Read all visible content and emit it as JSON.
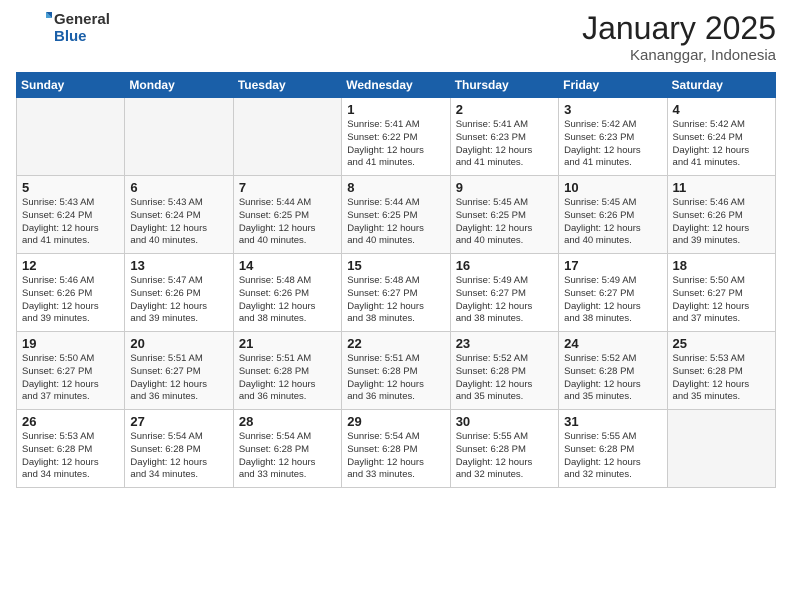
{
  "logo": {
    "general": "General",
    "blue": "Blue"
  },
  "title": {
    "month": "January 2025",
    "location": "Kananggar, Indonesia"
  },
  "weekdays": [
    "Sunday",
    "Monday",
    "Tuesday",
    "Wednesday",
    "Thursday",
    "Friday",
    "Saturday"
  ],
  "weeks": [
    [
      {
        "day": "",
        "info": ""
      },
      {
        "day": "",
        "info": ""
      },
      {
        "day": "",
        "info": ""
      },
      {
        "day": "1",
        "info": "Sunrise: 5:41 AM\nSunset: 6:22 PM\nDaylight: 12 hours\nand 41 minutes."
      },
      {
        "day": "2",
        "info": "Sunrise: 5:41 AM\nSunset: 6:23 PM\nDaylight: 12 hours\nand 41 minutes."
      },
      {
        "day": "3",
        "info": "Sunrise: 5:42 AM\nSunset: 6:23 PM\nDaylight: 12 hours\nand 41 minutes."
      },
      {
        "day": "4",
        "info": "Sunrise: 5:42 AM\nSunset: 6:24 PM\nDaylight: 12 hours\nand 41 minutes."
      }
    ],
    [
      {
        "day": "5",
        "info": "Sunrise: 5:43 AM\nSunset: 6:24 PM\nDaylight: 12 hours\nand 41 minutes."
      },
      {
        "day": "6",
        "info": "Sunrise: 5:43 AM\nSunset: 6:24 PM\nDaylight: 12 hours\nand 40 minutes."
      },
      {
        "day": "7",
        "info": "Sunrise: 5:44 AM\nSunset: 6:25 PM\nDaylight: 12 hours\nand 40 minutes."
      },
      {
        "day": "8",
        "info": "Sunrise: 5:44 AM\nSunset: 6:25 PM\nDaylight: 12 hours\nand 40 minutes."
      },
      {
        "day": "9",
        "info": "Sunrise: 5:45 AM\nSunset: 6:25 PM\nDaylight: 12 hours\nand 40 minutes."
      },
      {
        "day": "10",
        "info": "Sunrise: 5:45 AM\nSunset: 6:26 PM\nDaylight: 12 hours\nand 40 minutes."
      },
      {
        "day": "11",
        "info": "Sunrise: 5:46 AM\nSunset: 6:26 PM\nDaylight: 12 hours\nand 39 minutes."
      }
    ],
    [
      {
        "day": "12",
        "info": "Sunrise: 5:46 AM\nSunset: 6:26 PM\nDaylight: 12 hours\nand 39 minutes."
      },
      {
        "day": "13",
        "info": "Sunrise: 5:47 AM\nSunset: 6:26 PM\nDaylight: 12 hours\nand 39 minutes."
      },
      {
        "day": "14",
        "info": "Sunrise: 5:48 AM\nSunset: 6:26 PM\nDaylight: 12 hours\nand 38 minutes."
      },
      {
        "day": "15",
        "info": "Sunrise: 5:48 AM\nSunset: 6:27 PM\nDaylight: 12 hours\nand 38 minutes."
      },
      {
        "day": "16",
        "info": "Sunrise: 5:49 AM\nSunset: 6:27 PM\nDaylight: 12 hours\nand 38 minutes."
      },
      {
        "day": "17",
        "info": "Sunrise: 5:49 AM\nSunset: 6:27 PM\nDaylight: 12 hours\nand 38 minutes."
      },
      {
        "day": "18",
        "info": "Sunrise: 5:50 AM\nSunset: 6:27 PM\nDaylight: 12 hours\nand 37 minutes."
      }
    ],
    [
      {
        "day": "19",
        "info": "Sunrise: 5:50 AM\nSunset: 6:27 PM\nDaylight: 12 hours\nand 37 minutes."
      },
      {
        "day": "20",
        "info": "Sunrise: 5:51 AM\nSunset: 6:27 PM\nDaylight: 12 hours\nand 36 minutes."
      },
      {
        "day": "21",
        "info": "Sunrise: 5:51 AM\nSunset: 6:28 PM\nDaylight: 12 hours\nand 36 minutes."
      },
      {
        "day": "22",
        "info": "Sunrise: 5:51 AM\nSunset: 6:28 PM\nDaylight: 12 hours\nand 36 minutes."
      },
      {
        "day": "23",
        "info": "Sunrise: 5:52 AM\nSunset: 6:28 PM\nDaylight: 12 hours\nand 35 minutes."
      },
      {
        "day": "24",
        "info": "Sunrise: 5:52 AM\nSunset: 6:28 PM\nDaylight: 12 hours\nand 35 minutes."
      },
      {
        "day": "25",
        "info": "Sunrise: 5:53 AM\nSunset: 6:28 PM\nDaylight: 12 hours\nand 35 minutes."
      }
    ],
    [
      {
        "day": "26",
        "info": "Sunrise: 5:53 AM\nSunset: 6:28 PM\nDaylight: 12 hours\nand 34 minutes."
      },
      {
        "day": "27",
        "info": "Sunrise: 5:54 AM\nSunset: 6:28 PM\nDaylight: 12 hours\nand 34 minutes."
      },
      {
        "day": "28",
        "info": "Sunrise: 5:54 AM\nSunset: 6:28 PM\nDaylight: 12 hours\nand 33 minutes."
      },
      {
        "day": "29",
        "info": "Sunrise: 5:54 AM\nSunset: 6:28 PM\nDaylight: 12 hours\nand 33 minutes."
      },
      {
        "day": "30",
        "info": "Sunrise: 5:55 AM\nSunset: 6:28 PM\nDaylight: 12 hours\nand 32 minutes."
      },
      {
        "day": "31",
        "info": "Sunrise: 5:55 AM\nSunset: 6:28 PM\nDaylight: 12 hours\nand 32 minutes."
      },
      {
        "day": "",
        "info": ""
      }
    ]
  ]
}
